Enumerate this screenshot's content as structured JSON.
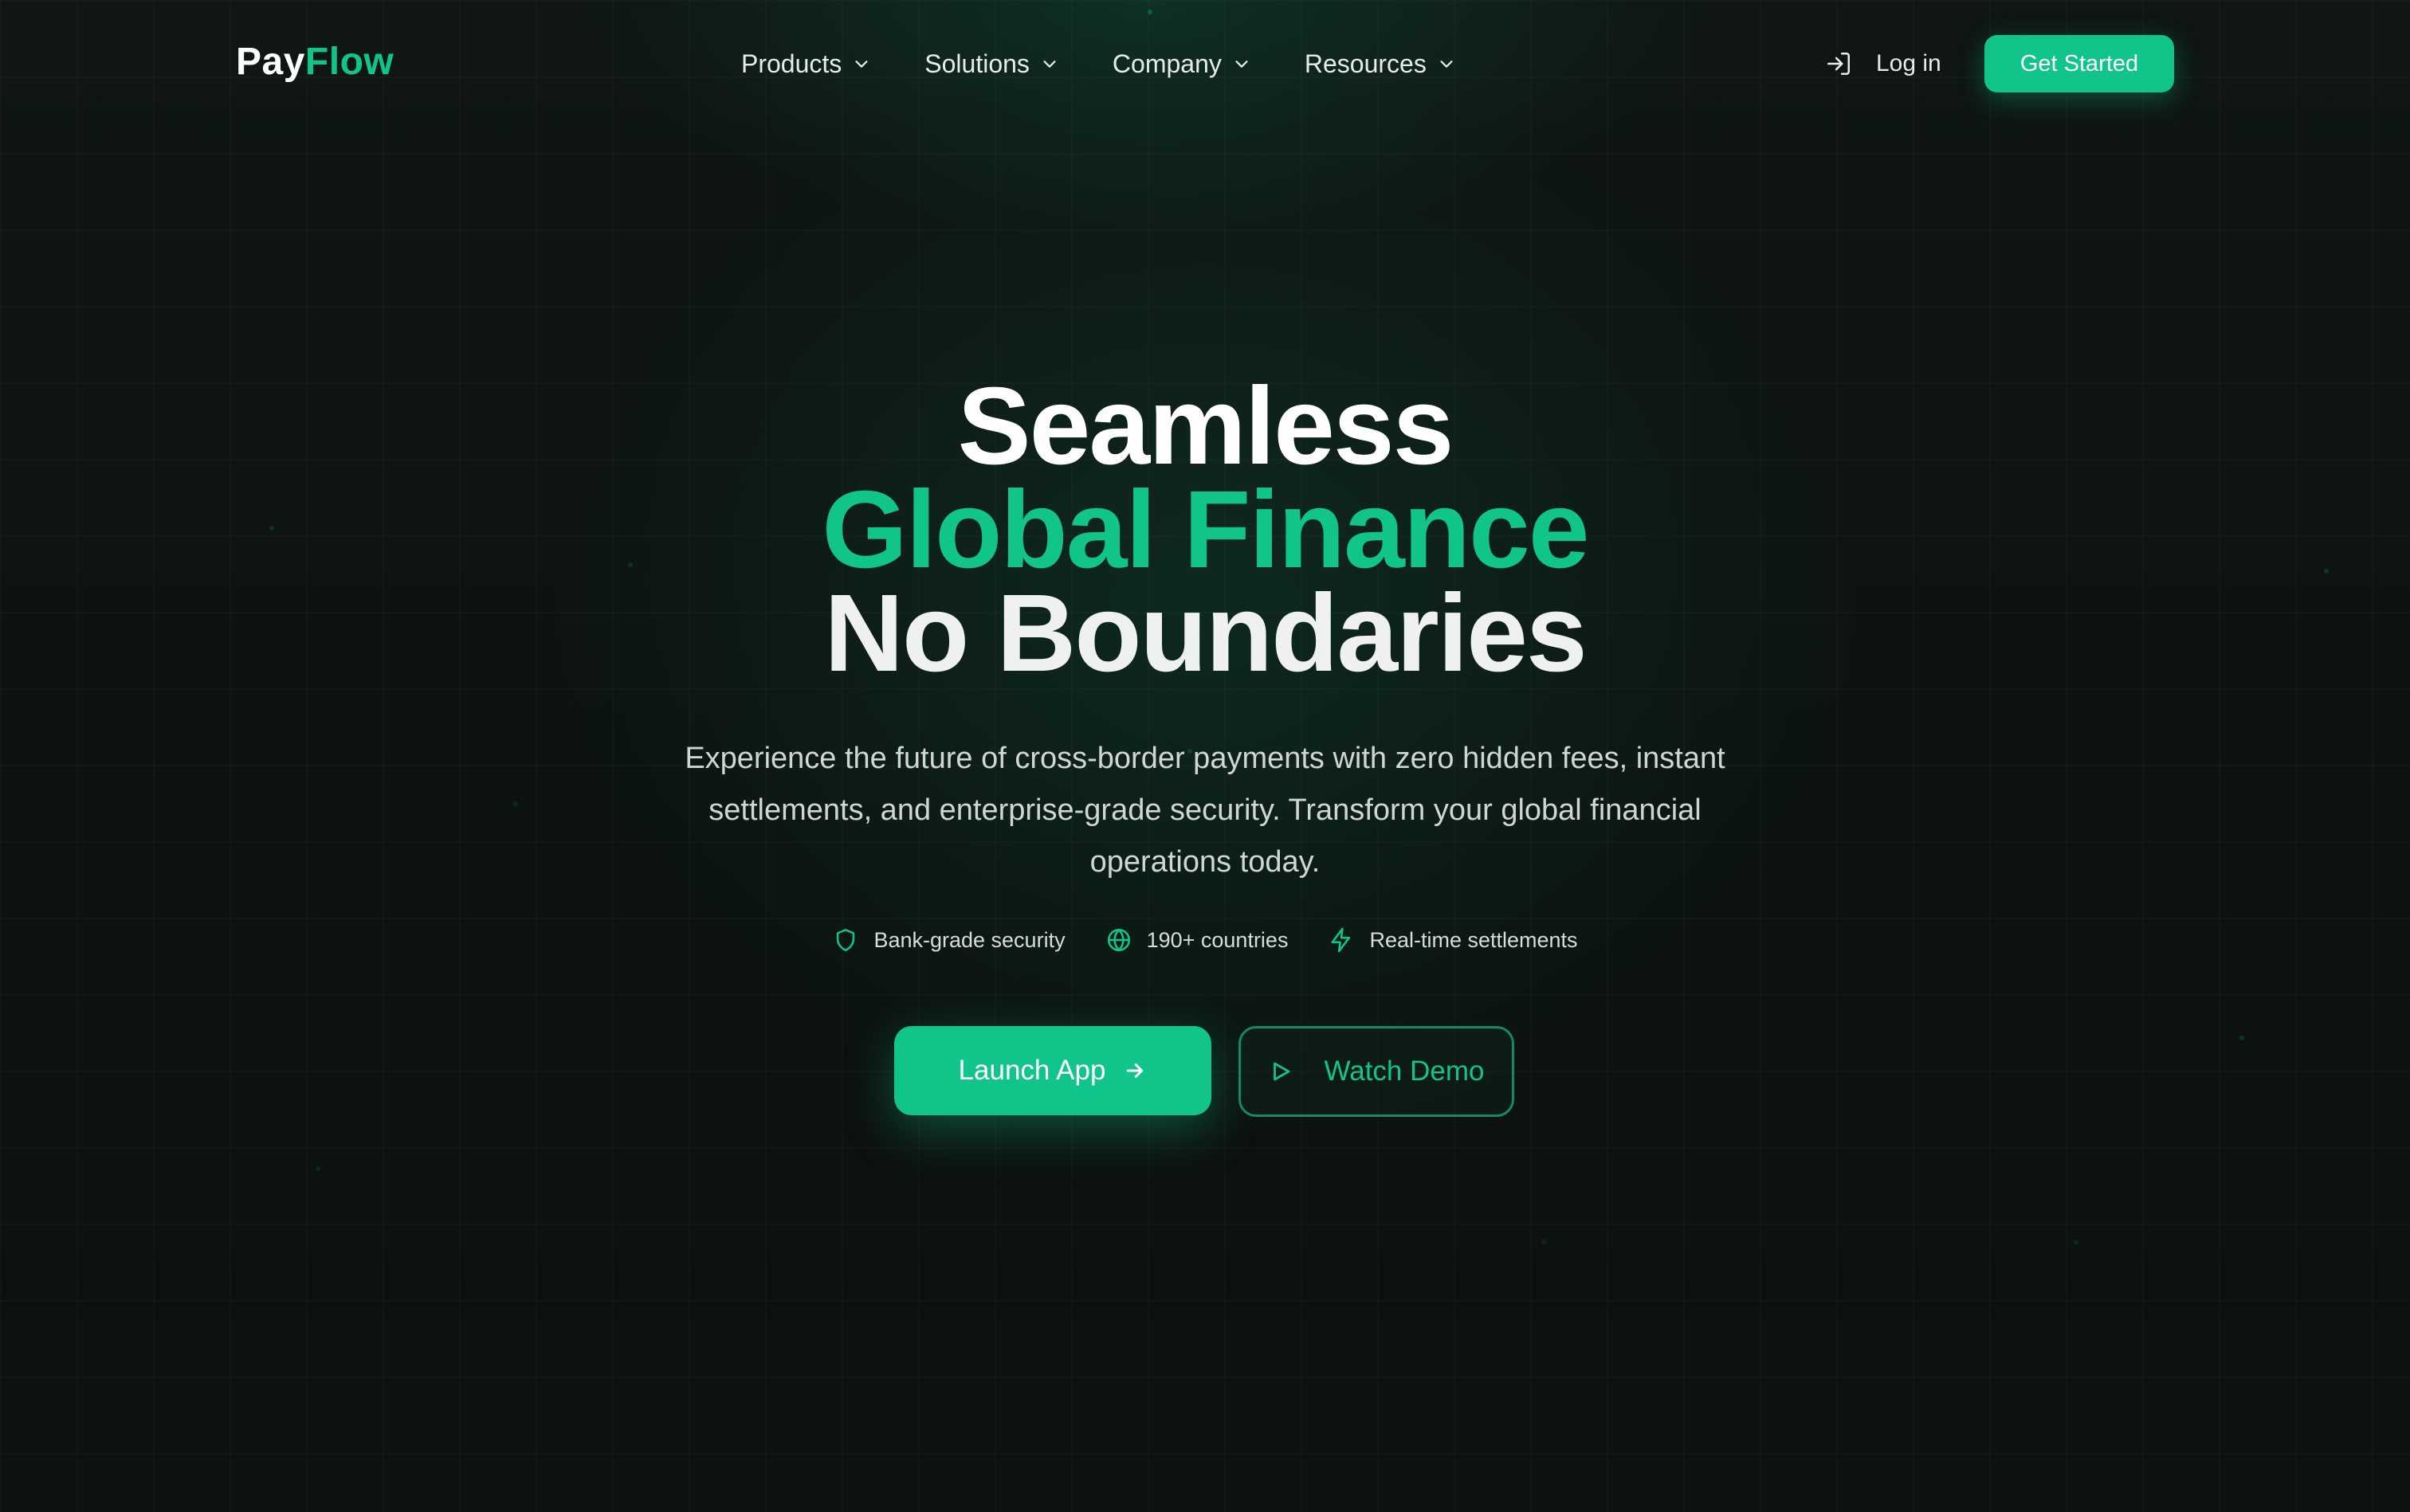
{
  "brand": {
    "part1": "Pay",
    "part2": "Flow"
  },
  "nav": {
    "items": [
      {
        "label": "Products"
      },
      {
        "label": "Solutions"
      },
      {
        "label": "Company"
      },
      {
        "label": "Resources"
      }
    ],
    "login_label": "Log in",
    "cta_label": "Get Started"
  },
  "hero": {
    "line1": "Seamless",
    "line2": "Global Finance",
    "line3": "No Boundaries",
    "subtitle": "Experience the future of cross-border payments with zero hidden fees, instant settlements, and enterprise-grade security. Transform your global financial operations today.",
    "features": [
      {
        "icon": "shield-icon",
        "label": "Bank-grade security"
      },
      {
        "icon": "globe-icon",
        "label": "190+ countries"
      },
      {
        "icon": "lightning-icon",
        "label": "Real-time settlements"
      }
    ],
    "primary_label": "Launch App",
    "secondary_label": "Watch Demo"
  },
  "colors": {
    "accent": "#10c48a",
    "background": "#0d1210",
    "text": "#ffffff"
  }
}
